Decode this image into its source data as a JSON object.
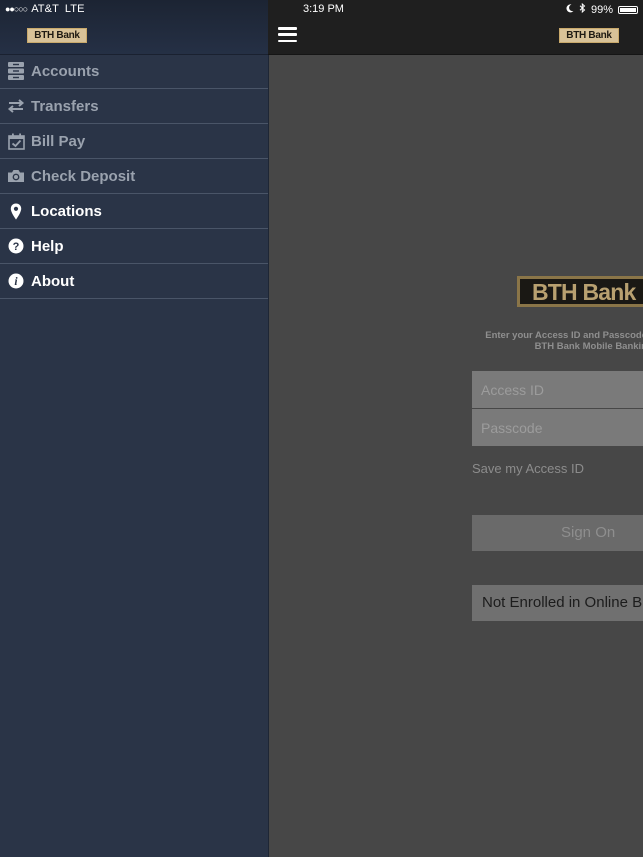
{
  "status_bar": {
    "signal": "●●○○○",
    "carrier": "AT&T",
    "network": "LTE",
    "time": "3:19 PM",
    "battery": "99%"
  },
  "brand": {
    "logo_text": "BTH Bank"
  },
  "sidebar": {
    "items": [
      {
        "label": "Accounts",
        "icon": "accounts-icon"
      },
      {
        "label": "Transfers",
        "icon": "transfers-icon"
      },
      {
        "label": "Bill Pay",
        "icon": "bill-pay-icon"
      },
      {
        "label": "Check Deposit",
        "icon": "camera-icon"
      },
      {
        "label": "Locations",
        "icon": "location-pin-icon"
      },
      {
        "label": "Help",
        "icon": "help-icon"
      },
      {
        "label": "About",
        "icon": "info-icon"
      }
    ]
  },
  "login": {
    "logo_text": "BTH Bank",
    "intro_line1": "Enter your Access ID and Passcode",
    "intro_line2": "BTH Bank Mobile Bankin",
    "access_id_placeholder": "Access ID",
    "passcode_placeholder": "Passcode",
    "save_label": "Save my Access ID",
    "sign_on_label": "Sign On",
    "enroll_label": "Not Enrolled in Online B"
  },
  "colors": {
    "sidebar_bg": "#2a3447",
    "main_bg": "#474747",
    "logo_gold": "#c9a96b"
  }
}
